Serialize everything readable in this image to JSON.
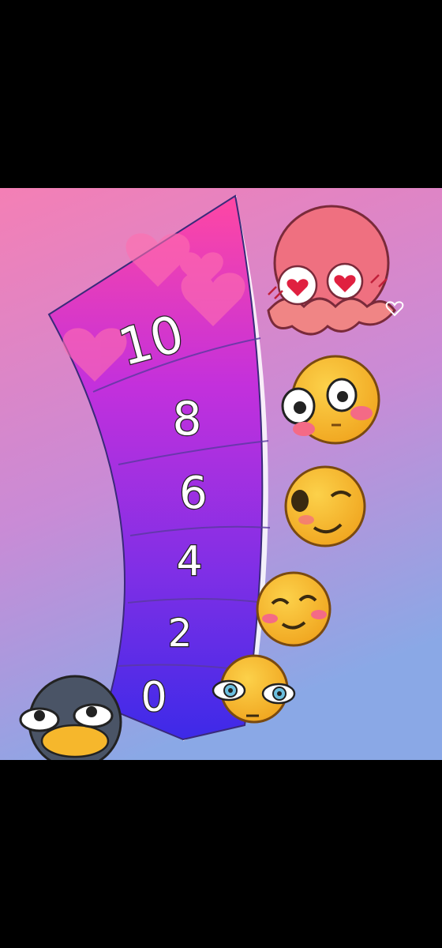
{
  "scale": {
    "labels": [
      "10",
      "8",
      "6",
      "4",
      "2",
      "0"
    ]
  },
  "colors": {
    "background_top": "#f37fb6",
    "background_bottom": "#8fa6e6",
    "scale_top": "#ff3fa0",
    "scale_bottom": "#3f28e6",
    "face_yellow": "#f6b72c",
    "face_red": "#ef6f7a",
    "penguin": "#4a5466"
  },
  "faces": [
    {
      "level": "10",
      "icon": "heart-eyes-octopus-face"
    },
    {
      "level": "8",
      "icon": "flushed-face"
    },
    {
      "level": "6",
      "icon": "winking-face"
    },
    {
      "level": "4",
      "icon": "smiling-blushing-face"
    },
    {
      "level": "2",
      "icon": "neutral-wide-eyes-face"
    },
    {
      "level": "0",
      "icon": "penguin-face"
    }
  ]
}
